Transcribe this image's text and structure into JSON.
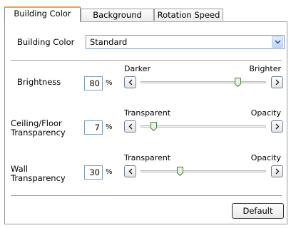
{
  "tabs": [
    {
      "label": "Building Color",
      "active": true
    },
    {
      "label": "Background",
      "active": false
    },
    {
      "label": "Rotation Speed",
      "active": false
    }
  ],
  "building_color": {
    "label": "Building Color",
    "value": "Standard"
  },
  "brightness": {
    "label": "Brightness",
    "value": "80",
    "unit": "%",
    "left_label": "Darker",
    "right_label": "Brighter",
    "level": 0.8
  },
  "ceiling_floor": {
    "label_line1": "Ceiling/Floor",
    "label_line2": "Transparency",
    "value": "7",
    "unit": "%",
    "left_label": "Transparent",
    "right_label": "Opacity",
    "level": 0.07
  },
  "wall": {
    "label_line1": "Wall",
    "label_line2": "Transparency",
    "value": "30",
    "unit": "%",
    "left_label": "Transparent",
    "right_label": "Opacity",
    "level": 0.3
  },
  "default_button": "Default",
  "colors": {
    "active_tab_accent": "#f4a23a",
    "input_border": "#7f9db9",
    "thumb_fill": "#e8f2e0",
    "thumb_border": "#4f7a43"
  }
}
